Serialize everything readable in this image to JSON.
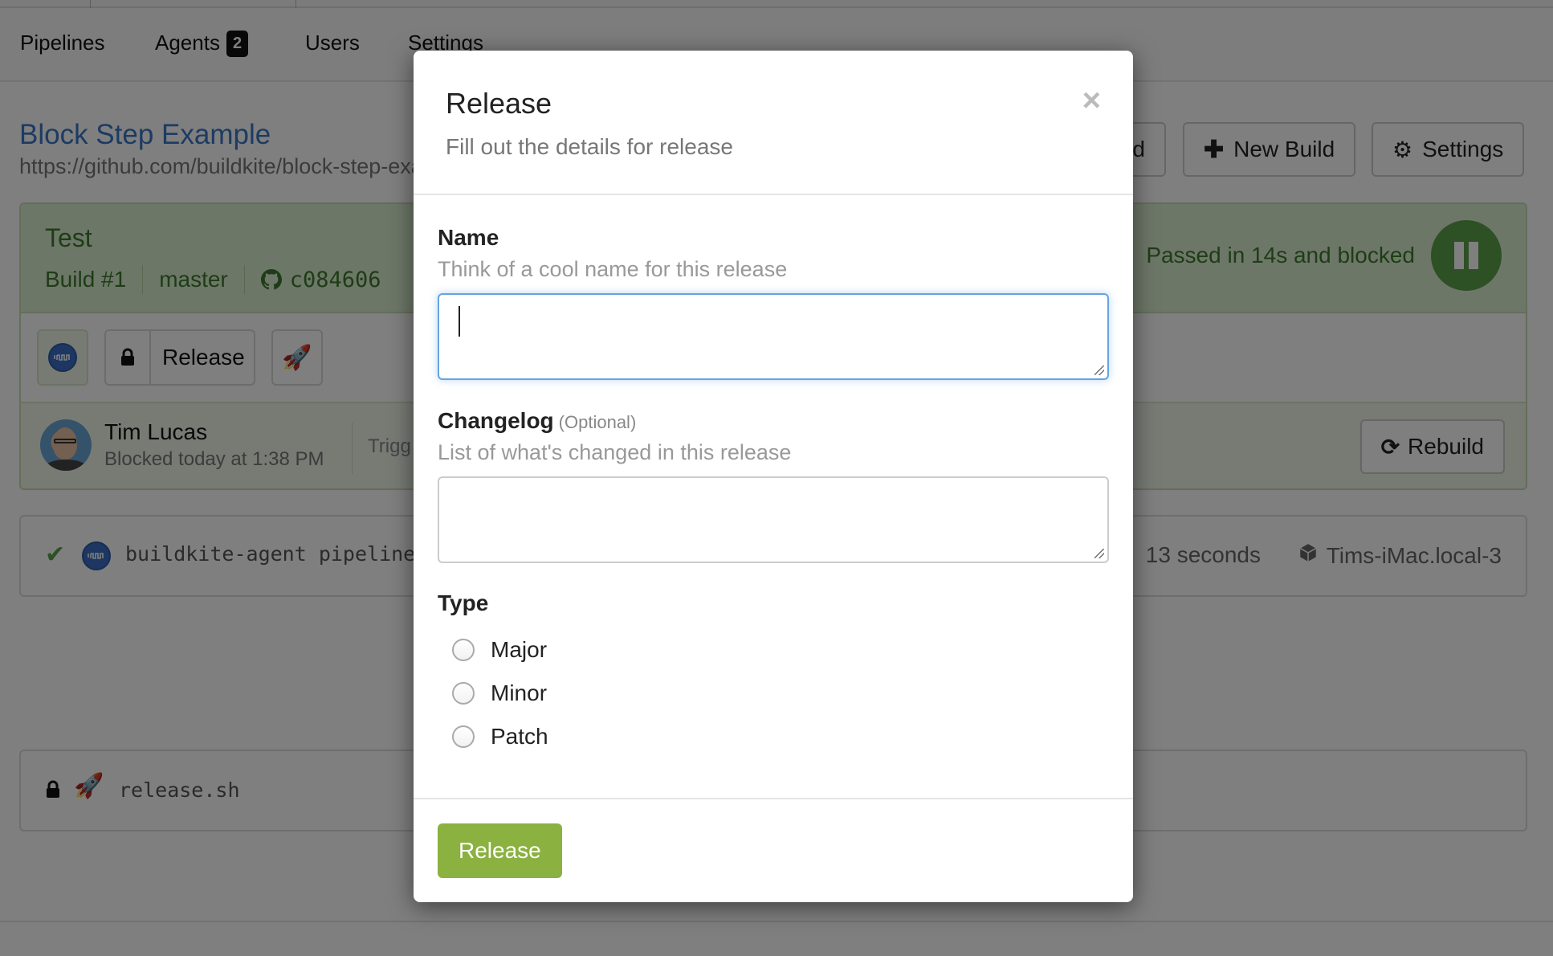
{
  "nav": {
    "items": [
      {
        "label": "Pipelines"
      },
      {
        "label": "Agents",
        "badge": "2"
      },
      {
        "label": "Users"
      },
      {
        "label": "Settings"
      }
    ]
  },
  "pipeline": {
    "title": "Block Step Example",
    "url": "https://github.com/buildkite/block-step-example",
    "buttons": {
      "partial_label": "d",
      "new_build": "New Build",
      "settings": "Settings"
    }
  },
  "build": {
    "message": "Test",
    "number": "Build #1",
    "branch": "master",
    "commit": "c084606",
    "status": "Passed in 14s and blocked",
    "status_color": "#5aa14a",
    "steps": [
      {
        "type": "command",
        "icon": "buildkite-agent-icon"
      },
      {
        "type": "block",
        "icon": "lock-icon",
        "label": "Release"
      },
      {
        "type": "command",
        "icon": "rocket-icon",
        "emoji": "🚀"
      }
    ],
    "creator": {
      "name": "Tim Lucas",
      "when": "Blocked today at 1:38 PM",
      "triggered_partial": "Trigg"
    },
    "rebuild_label": "Rebuild"
  },
  "jobs": [
    {
      "command": "buildkite-agent pipeline",
      "duration": "13 seconds",
      "agent": "Tims-iMac.local-3",
      "status": "passed"
    },
    {
      "command": "release.sh",
      "emoji": "🚀",
      "status": "blocked"
    }
  ],
  "modal": {
    "title": "Release",
    "subtitle": "Fill out the details for release",
    "close_glyph": "×",
    "fields": {
      "name": {
        "label": "Name",
        "hint": "Think of a cool name for this release",
        "value": ""
      },
      "changelog": {
        "label": "Changelog",
        "optional": "(Optional)",
        "hint": "List of what's changed in this release",
        "value": ""
      },
      "type": {
        "label": "Type",
        "options": [
          "Major",
          "Minor",
          "Patch"
        ],
        "selected": null
      }
    },
    "submit_label": "Release",
    "submit_color": "#8bb140"
  }
}
